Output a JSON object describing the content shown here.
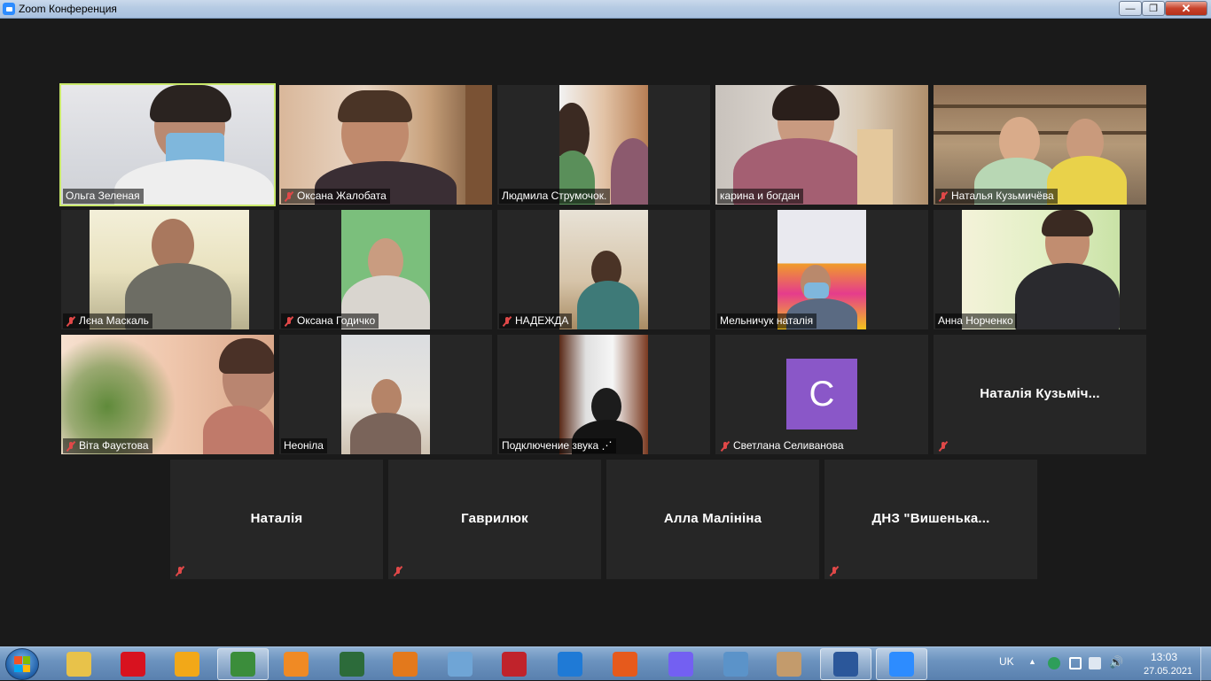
{
  "window": {
    "title": "Zoom Конференция",
    "minimize_glyph": "—",
    "maximize_glyph": "❐",
    "close_glyph": "✕"
  },
  "participants": [
    {
      "name": "Ольга Зеленая",
      "muted": false,
      "video": true,
      "active_speaker": true
    },
    {
      "name": "Оксана Жалобата",
      "muted": true,
      "video": true
    },
    {
      "name": "Людмила Струмочок.",
      "muted": false,
      "video": true
    },
    {
      "name": "карина и богдан",
      "muted": false,
      "video": true
    },
    {
      "name": "Наталья Кузьмичёва",
      "muted": true,
      "video": true
    },
    {
      "name": "Лєна Маскаль",
      "muted": true,
      "video": true
    },
    {
      "name": "Оксана Годичко",
      "muted": true,
      "video": true
    },
    {
      "name": "НАДЕЖДА",
      "muted": true,
      "video": true
    },
    {
      "name": "Мельничук наталія",
      "muted": false,
      "video": true
    },
    {
      "name": "Анна Норченко",
      "muted": false,
      "video": true
    },
    {
      "name": "Віта Фаустова",
      "muted": true,
      "video": true
    },
    {
      "name": "Неоніла",
      "muted": false,
      "video": true
    },
    {
      "name": "Подключение звука ⋰",
      "muted": false,
      "video": true
    },
    {
      "name": "Светлана Селиванова",
      "muted": true,
      "video": false,
      "avatar_letter": "C",
      "avatar_color": "#8a57c8"
    },
    {
      "name": "Наталія Кузьміч...",
      "muted": true,
      "video": false
    },
    {
      "name": "Наталія",
      "muted": true,
      "video": false
    },
    {
      "name": "Гаврилюк",
      "muted": true,
      "video": false
    },
    {
      "name": "Алла Малініна",
      "muted": false,
      "video": false
    },
    {
      "name": "ДНЗ  \"Вишенька...",
      "muted": true,
      "video": false
    }
  ],
  "taskbar": {
    "apps": [
      {
        "name": "file-explorer-icon",
        "color": "#e8c24a"
      },
      {
        "name": "opera-icon",
        "color": "#d8121f"
      },
      {
        "name": "aimp-icon",
        "color": "#f2a818"
      },
      {
        "name": "chrome-icon",
        "color": "#3b8d3b",
        "active": true
      },
      {
        "name": "media-player-icon",
        "color": "#f08a24"
      },
      {
        "name": "solitaire-icon",
        "color": "#2c6b3a"
      },
      {
        "name": "game-icon",
        "color": "#e3791c"
      },
      {
        "name": "paint-icon",
        "color": "#6fa5d6"
      },
      {
        "name": "hearts-icon",
        "color": "#c0232b"
      },
      {
        "name": "internet-explorer-icon",
        "color": "#1f7ad6"
      },
      {
        "name": "kids-game-icon",
        "color": "#e65a1c"
      },
      {
        "name": "viber-icon",
        "color": "#7360f2"
      },
      {
        "name": "eyes-icon",
        "color": "#5b93c9"
      },
      {
        "name": "mahjong-icon",
        "color": "#c39b6c"
      },
      {
        "name": "word-icon",
        "color": "#2b579a",
        "active": true
      },
      {
        "name": "zoom-icon",
        "color": "#2d8cff",
        "active": true
      }
    ],
    "tray": {
      "language": "UK",
      "time": "13:03",
      "date": "27.05.2021"
    }
  }
}
